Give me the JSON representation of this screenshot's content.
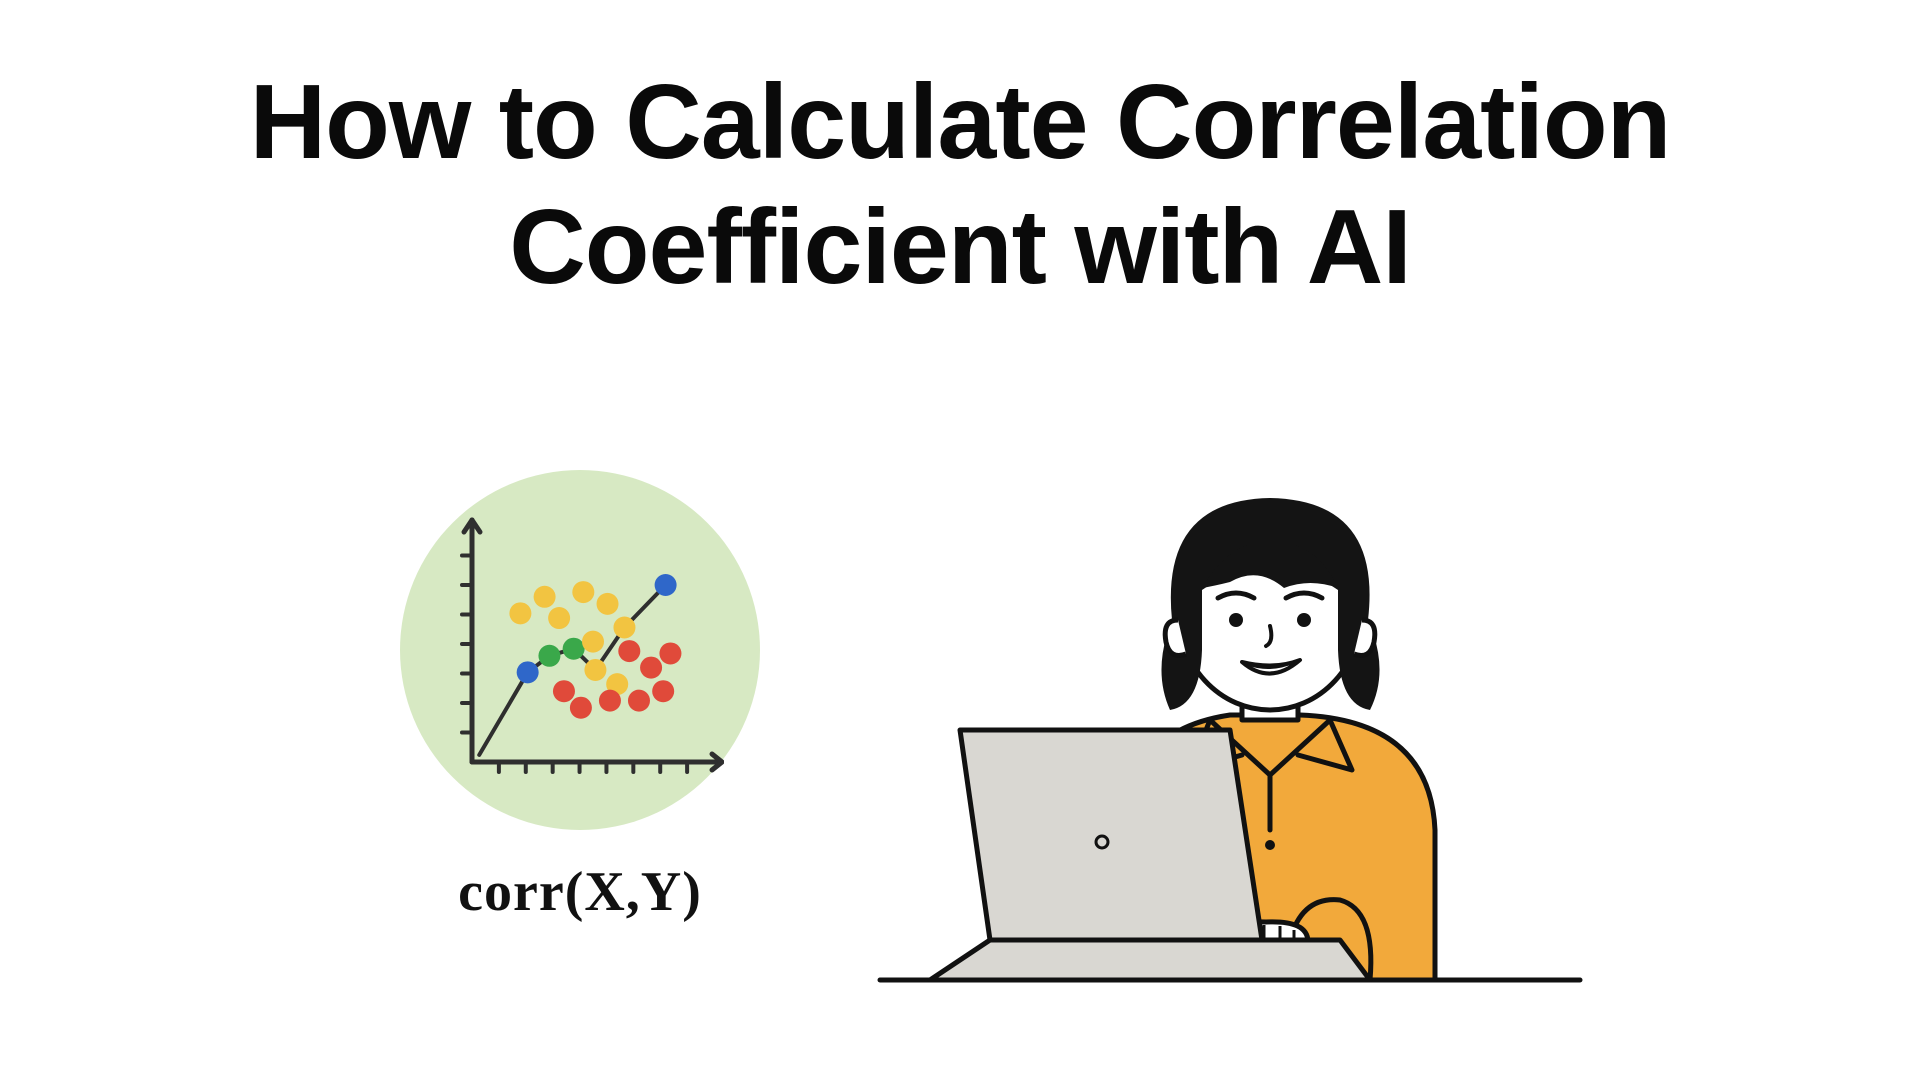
{
  "title": "How to Calculate Correlation Coefficient with AI",
  "formula": "corr(X,Y)",
  "colors": {
    "circle_bg": "#d7e9c3",
    "axis": "#2f2f2f",
    "blue": "#2f67c9",
    "green": "#3aa84a",
    "yellow": "#f2c441",
    "red": "#e04a3a",
    "shirt": "#f2a93b",
    "hair": "#141414",
    "skin": "#ffffff",
    "laptop": "#d9d7d2",
    "line": "#111111"
  },
  "chart_data": {
    "type": "scatter",
    "title": "",
    "xlabel": "",
    "ylabel": "",
    "xlim": [
      0,
      10
    ],
    "ylim": [
      0,
      10
    ],
    "series": [
      {
        "name": "trend-line",
        "color_key": "axis",
        "type": "line",
        "x": [
          0.3,
          2.3,
          3.2,
          4.2,
          5.1,
          6.3,
          8.0
        ],
        "y": [
          0.3,
          3.8,
          4.5,
          4.8,
          3.9,
          5.7,
          7.5
        ]
      },
      {
        "name": "blue-points",
        "color_key": "blue",
        "x": [
          2.3,
          8.0
        ],
        "y": [
          3.8,
          7.5
        ]
      },
      {
        "name": "green-points",
        "color_key": "green",
        "x": [
          3.2,
          4.2
        ],
        "y": [
          4.5,
          4.8
        ]
      },
      {
        "name": "yellow-points",
        "color_key": "yellow",
        "x": [
          2.0,
          3.0,
          3.6,
          4.6,
          5.0,
          5.1,
          5.6,
          6.0,
          6.3
        ],
        "y": [
          6.3,
          7.0,
          6.1,
          7.2,
          5.1,
          3.9,
          6.7,
          3.3,
          5.7
        ]
      },
      {
        "name": "red-points",
        "color_key": "red",
        "x": [
          3.8,
          4.5,
          5.7,
          6.5,
          6.9,
          7.4,
          7.9,
          8.2
        ],
        "y": [
          3.0,
          2.3,
          2.6,
          4.7,
          2.6,
          4.0,
          3.0,
          4.6
        ]
      }
    ],
    "x_ticks": 8,
    "y_ticks": 7
  }
}
